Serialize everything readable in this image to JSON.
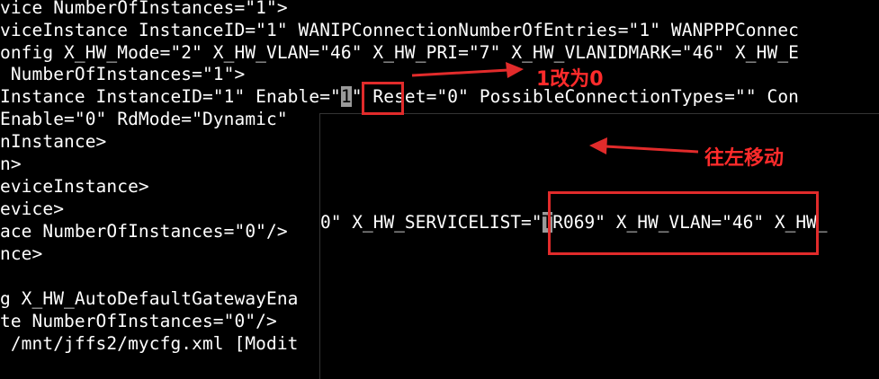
{
  "terminal": {
    "lines": [
      "vice NumberOfInstances=\"1\">",
      "viceInstance InstanceID=\"1\" WANIPConnectionNumberOfEntries=\"1\" WANPPPConnec",
      "onfig X_HW_Mode=\"2\" X_HW_VLAN=\"46\" X_HW_PRI=\"7\" X_HW_VLANIDMARK=\"46\" X_HW_E",
      " NumberOfInstances=\"1\">",
      "Instance InstanceID=\"1\" Enable=\"",
      "1",
      "\" Reset=\"0\" PossibleConnectionTypes=\"\" Con",
      "Enable=\"0\" RdMode=\"Dynamic\"",
      "nInstance>",
      "n>",
      "eviceInstance>",
      "evice>",
      "ace NumberOfInstances=\"0\"/>",
      "nce>",
      "",
      "g X_HW_AutoDefaultGatewayEna",
      "te NumberOfInstances=\"0\"/>",
      " /mnt/jffs2/mycfg.xml [Modit"
    ]
  },
  "overlay": {
    "before": "0\" X_HW_SERVICELIST=\"",
    "cursor": "T",
    "after": "R069\" X_HW_VLAN=\"46\" X_HW_"
  },
  "annotations": {
    "change_note": "1改为0",
    "move_note": "往左移动",
    "color": "#e12b2b"
  }
}
